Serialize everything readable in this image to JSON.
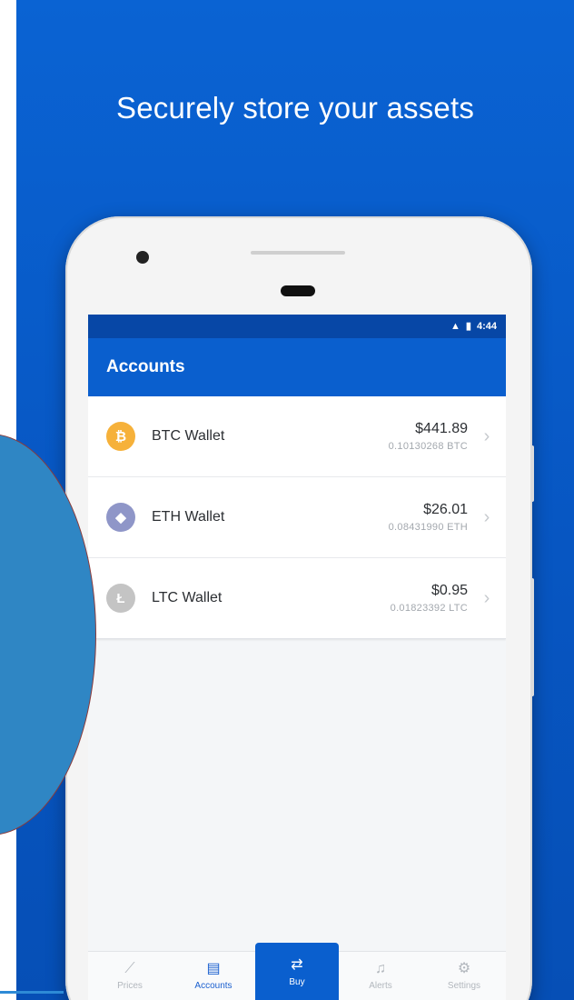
{
  "headline": "Securely store your assets",
  "colors": {
    "brand_blue": "#0a5fce",
    "btc": "#f6b13a",
    "eth": "#8f96c8",
    "ltc": "#c4c4c4"
  },
  "status_bar": {
    "signal_icon": "signal-icon",
    "battery_icon": "battery-icon",
    "time": "4:44"
  },
  "app_bar": {
    "title": "Accounts"
  },
  "wallets": [
    {
      "name": "BTC Wallet",
      "fiat": "$441.89",
      "crypto": "0.10130268 BTC",
      "icon": "bitcoin-icon",
      "glyph": "₿"
    },
    {
      "name": "ETH Wallet",
      "fiat": "$26.01",
      "crypto": "0.08431990 ETH",
      "icon": "ethereum-icon",
      "glyph": "◆"
    },
    {
      "name": "LTC Wallet",
      "fiat": "$0.95",
      "crypto": "0.01823392 LTC",
      "icon": "litecoin-icon",
      "glyph": "Ł"
    }
  ],
  "tabs": [
    {
      "label": "Prices",
      "icon": "chart-icon",
      "glyph": "⟋"
    },
    {
      "label": "Accounts",
      "icon": "wallet-icon",
      "glyph": "▤"
    },
    {
      "label": "Buy",
      "icon": "exchange-icon",
      "glyph": "⇄"
    },
    {
      "label": "Alerts",
      "icon": "bell-icon",
      "glyph": "🔔"
    },
    {
      "label": "Settings",
      "icon": "gear-icon",
      "glyph": "⚙"
    }
  ]
}
